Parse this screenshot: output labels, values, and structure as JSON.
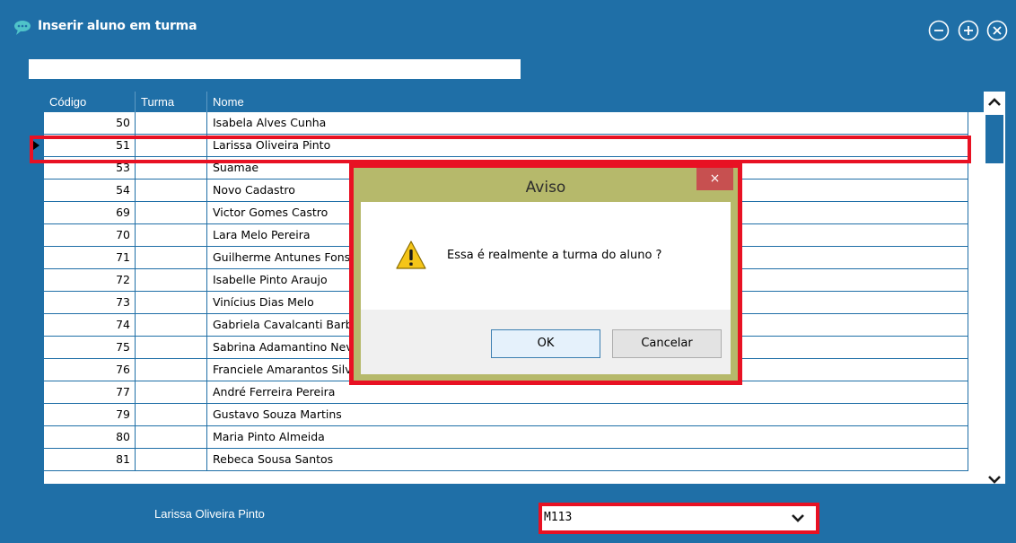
{
  "window": {
    "title": "Inserir aluno em turma",
    "colors": {
      "frame": "#1f6fa7",
      "highlight": "#e81123"
    }
  },
  "search": {
    "value": "",
    "placeholder": ""
  },
  "grid": {
    "columns": [
      "Código",
      "Turma",
      "Nome"
    ],
    "rows": [
      {
        "codigo": "50",
        "turma": "",
        "nome": "Isabela Alves Cunha"
      },
      {
        "codigo": "51",
        "turma": "",
        "nome": "Larissa Oliveira Pinto",
        "selected": true
      },
      {
        "codigo": "53",
        "turma": "",
        "nome": "Suamae"
      },
      {
        "codigo": "54",
        "turma": "",
        "nome": "Novo Cadastro"
      },
      {
        "codigo": "69",
        "turma": "",
        "nome": "Victor Gomes Castro"
      },
      {
        "codigo": "70",
        "turma": "",
        "nome": "Lara Melo Pereira"
      },
      {
        "codigo": "71",
        "turma": "",
        "nome": "Guilherme Antunes Fonseca"
      },
      {
        "codigo": "72",
        "turma": "",
        "nome": "Isabelle Pinto Araujo"
      },
      {
        "codigo": "73",
        "turma": "",
        "nome": "Vinícius Dias Melo"
      },
      {
        "codigo": "74",
        "turma": "",
        "nome": "Gabriela Cavalcanti Barbosa"
      },
      {
        "codigo": "75",
        "turma": "",
        "nome": "Sabrina Adamantino Neves"
      },
      {
        "codigo": "76",
        "turma": "",
        "nome": "Franciele Amarantos Silva"
      },
      {
        "codigo": "77",
        "turma": "",
        "nome": "André Ferreira Pereira"
      },
      {
        "codigo": "79",
        "turma": "",
        "nome": "Gustavo Souza Martins"
      },
      {
        "codigo": "80",
        "turma": "",
        "nome": "Maria Pinto Almeida"
      },
      {
        "codigo": "81",
        "turma": "",
        "nome": "Rebeca Sousa Santos"
      }
    ]
  },
  "footer": {
    "student_name": "Larissa Oliveira Pinto",
    "turma_selected": "M113"
  },
  "dialog": {
    "title": "Aviso",
    "close_label": "×",
    "message": "Essa é realmente a turma do aluno ?",
    "ok_label": "OK",
    "cancel_label": "Cancelar",
    "icon": "warning-icon"
  }
}
